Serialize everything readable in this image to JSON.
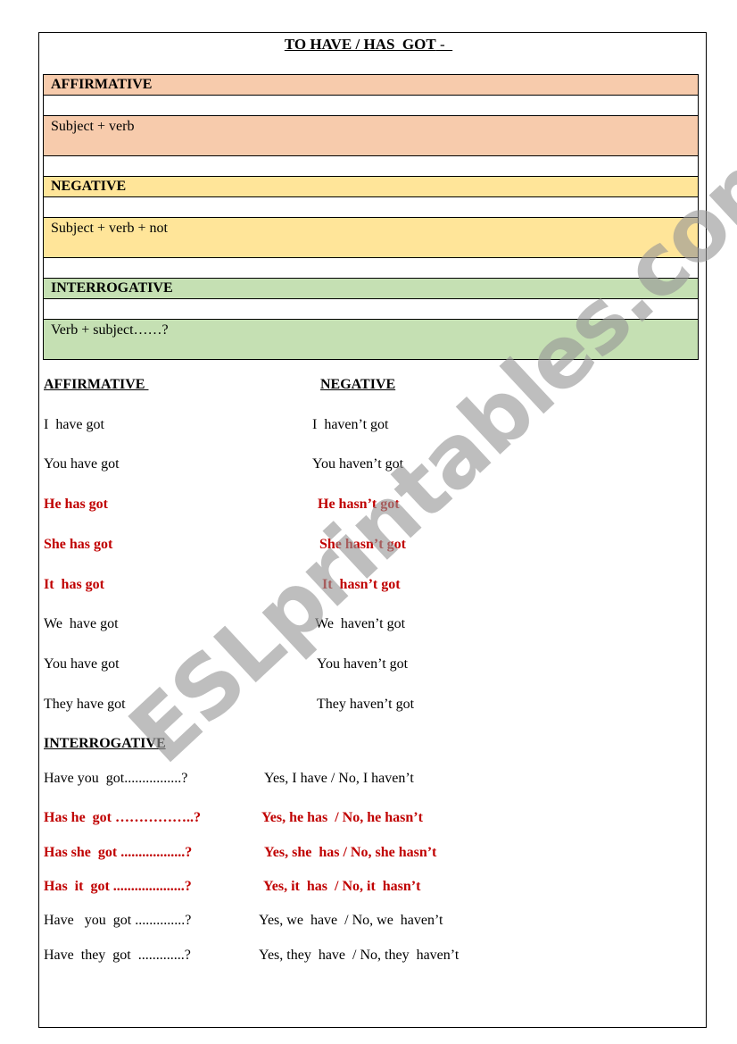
{
  "title": {
    "main": "TO HAVE / HAS  GOT",
    "suffix": " -  "
  },
  "colors": {
    "affirmative": "#F7CBAC",
    "negative": "#FFE599",
    "interrogative": "#C5E0B3",
    "highlight_text": "#C00000"
  },
  "rules": {
    "affirmative": {
      "heading": "AFFIRMATIVE",
      "formula": "Subject + verb"
    },
    "negative": {
      "heading": "NEGATIVE",
      "formula": "Subject + verb + not"
    },
    "interrogative": {
      "heading": "INTERROGATIVE",
      "formula": "Verb + subject……?"
    }
  },
  "conjugation": {
    "affirmative_heading": "AFFIRMATIVE ",
    "negative_heading": "NEGATIVE",
    "rows": [
      {
        "affirmative": "I  have got",
        "negative": "I  haven’t got",
        "highlight": false
      },
      {
        "affirmative": "You have got",
        "negative": "You haven’t got",
        "highlight": false
      },
      {
        "affirmative": "He has got",
        "negative": "He hasn’t got",
        "highlight": true
      },
      {
        "affirmative": "She has got",
        "negative": "She hasn’t got",
        "highlight": true
      },
      {
        "affirmative": "It  has got",
        "negative": "It  hasn’t got",
        "highlight": true
      },
      {
        "affirmative": "We  have got",
        "negative": "We  haven’t got",
        "highlight": false
      },
      {
        "affirmative": "You have got",
        "negative": "You haven’t got",
        "highlight": false
      },
      {
        "affirmative": "They have got",
        "negative": "They haven’t got",
        "highlight": false
      }
    ]
  },
  "interrogative": {
    "heading": "INTERROGATIVE",
    "rows": [
      {
        "question": "Have you  got................?",
        "answer": "Yes, I have / No, I haven’t",
        "highlight": false
      },
      {
        "question": "Has he  got ……………..?",
        "answer": "Yes, he has  / No, he hasn’t",
        "highlight": true
      },
      {
        "question": "Has she  got ..................?",
        "answer": "Yes, she  has / No, she hasn’t",
        "highlight": true
      },
      {
        "question": "Has  it  got ....................?",
        "answer": "Yes, it  has  / No, it  hasn’t",
        "highlight": true
      },
      {
        "question": "Have   you  got ..............?",
        "answer": "Yes, we  have  / No, we  haven’t",
        "highlight": false
      },
      {
        "question": "Have  they  got  .............?",
        "answer": "Yes, they  have  / No, they  haven’t",
        "highlight": false
      }
    ]
  },
  "watermark": "ESLprintables.com"
}
